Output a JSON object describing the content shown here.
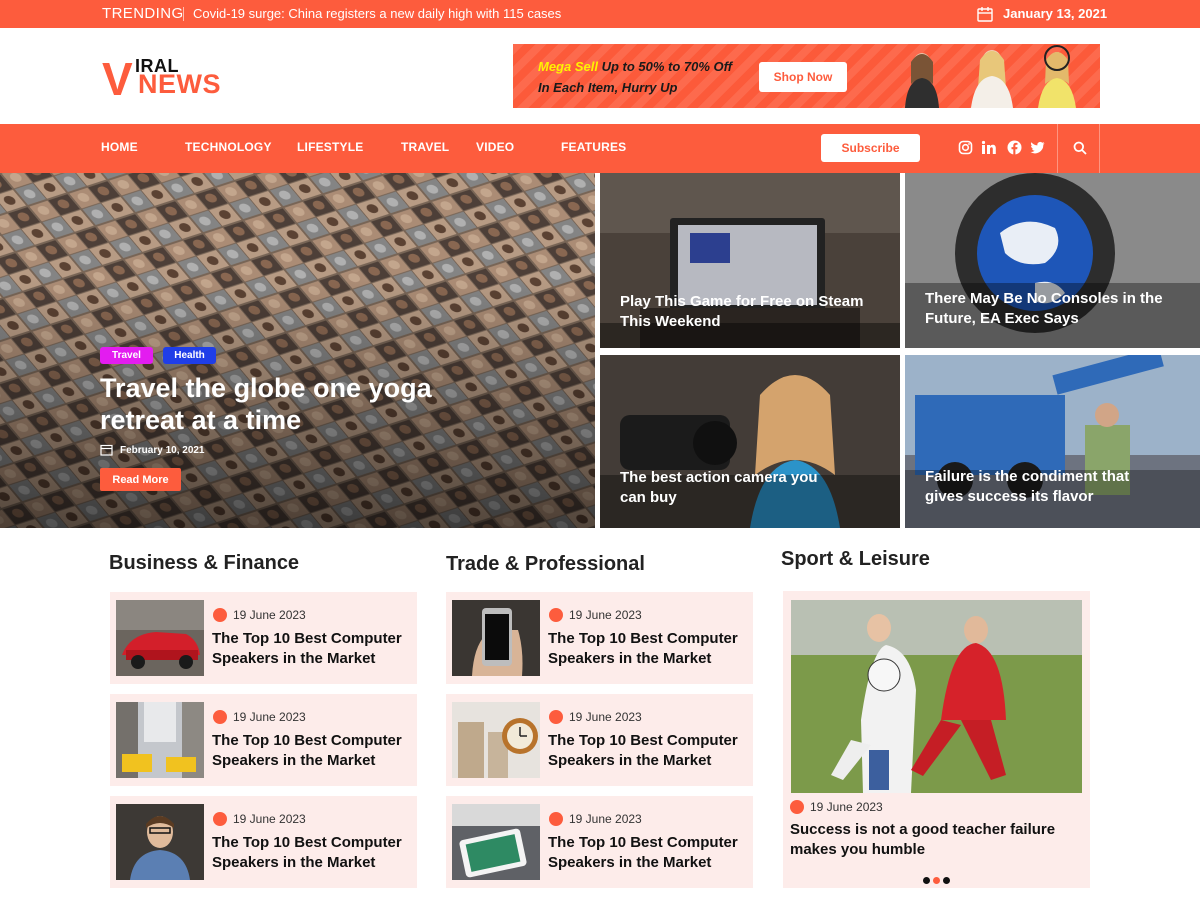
{
  "topbar": {
    "trending_label": "TRENDING",
    "trending_text": "Covid-19 surge: China registers a new daily high with 115 cases",
    "date": "January 13, 2021"
  },
  "logo": {
    "v": "V",
    "iral": "IRAL",
    "news": "NEWS"
  },
  "ad": {
    "line1_highlight": "Mega Sell",
    "line1_rest": " Up to 50% to 70% Off",
    "line2": "In Each Item, Hurry Up",
    "button": "Shop Now"
  },
  "nav": {
    "items": [
      "HOME",
      "TECHNOLOGY",
      "LIFESTYLE",
      "TRAVEL",
      "VIDEO",
      "FEATURES"
    ],
    "subscribe": "Subscribe",
    "social_icons": [
      "instagram-icon",
      "linkedin-icon",
      "facebook-icon",
      "twitter-icon"
    ]
  },
  "hero": {
    "tags": [
      "Travel",
      "Health"
    ],
    "title": "Travel the globe one yoga retreat at a time",
    "date": "February 10, 2021",
    "read_more": "Read More"
  },
  "tiles": [
    {
      "title": "Play This Game for Free on Steam This Weekend"
    },
    {
      "title": "There May Be No Consoles in the Future, EA Exec Says"
    },
    {
      "title": "The best action camera you can buy"
    },
    {
      "title": "Failure is the condiment that gives success its flavor"
    }
  ],
  "sections": {
    "business": {
      "title": "Business & Finance",
      "cards": [
        {
          "date": "19 June 2023",
          "title": "The Top 10 Best Computer Speakers in the Market"
        },
        {
          "date": "19 June 2023",
          "title": "The Top 10 Best Computer Speakers in the Market"
        },
        {
          "date": "19 June 2023",
          "title": "The Top 10 Best Computer Speakers in the Market"
        }
      ]
    },
    "trade": {
      "title": "Trade & Professional",
      "cards": [
        {
          "date": "19 June 2023",
          "title": "The Top 10 Best Computer Speakers in the Market"
        },
        {
          "date": "19 June 2023",
          "title": "The Top 10 Best Computer Speakers in the Market"
        },
        {
          "date": "19 June 2023",
          "title": "The Top 10 Best Computer Speakers in the Market"
        }
      ]
    },
    "sport": {
      "title": "Sport & Leisure",
      "date": "19 June 2023",
      "title_card": "Success is not a good teacher failure makes you humble"
    }
  },
  "colors": {
    "accent": "#fd5c3d",
    "card_bg": "#fdecea",
    "tag_travel": "#e31cf0",
    "tag_health": "#1f3ee8"
  }
}
